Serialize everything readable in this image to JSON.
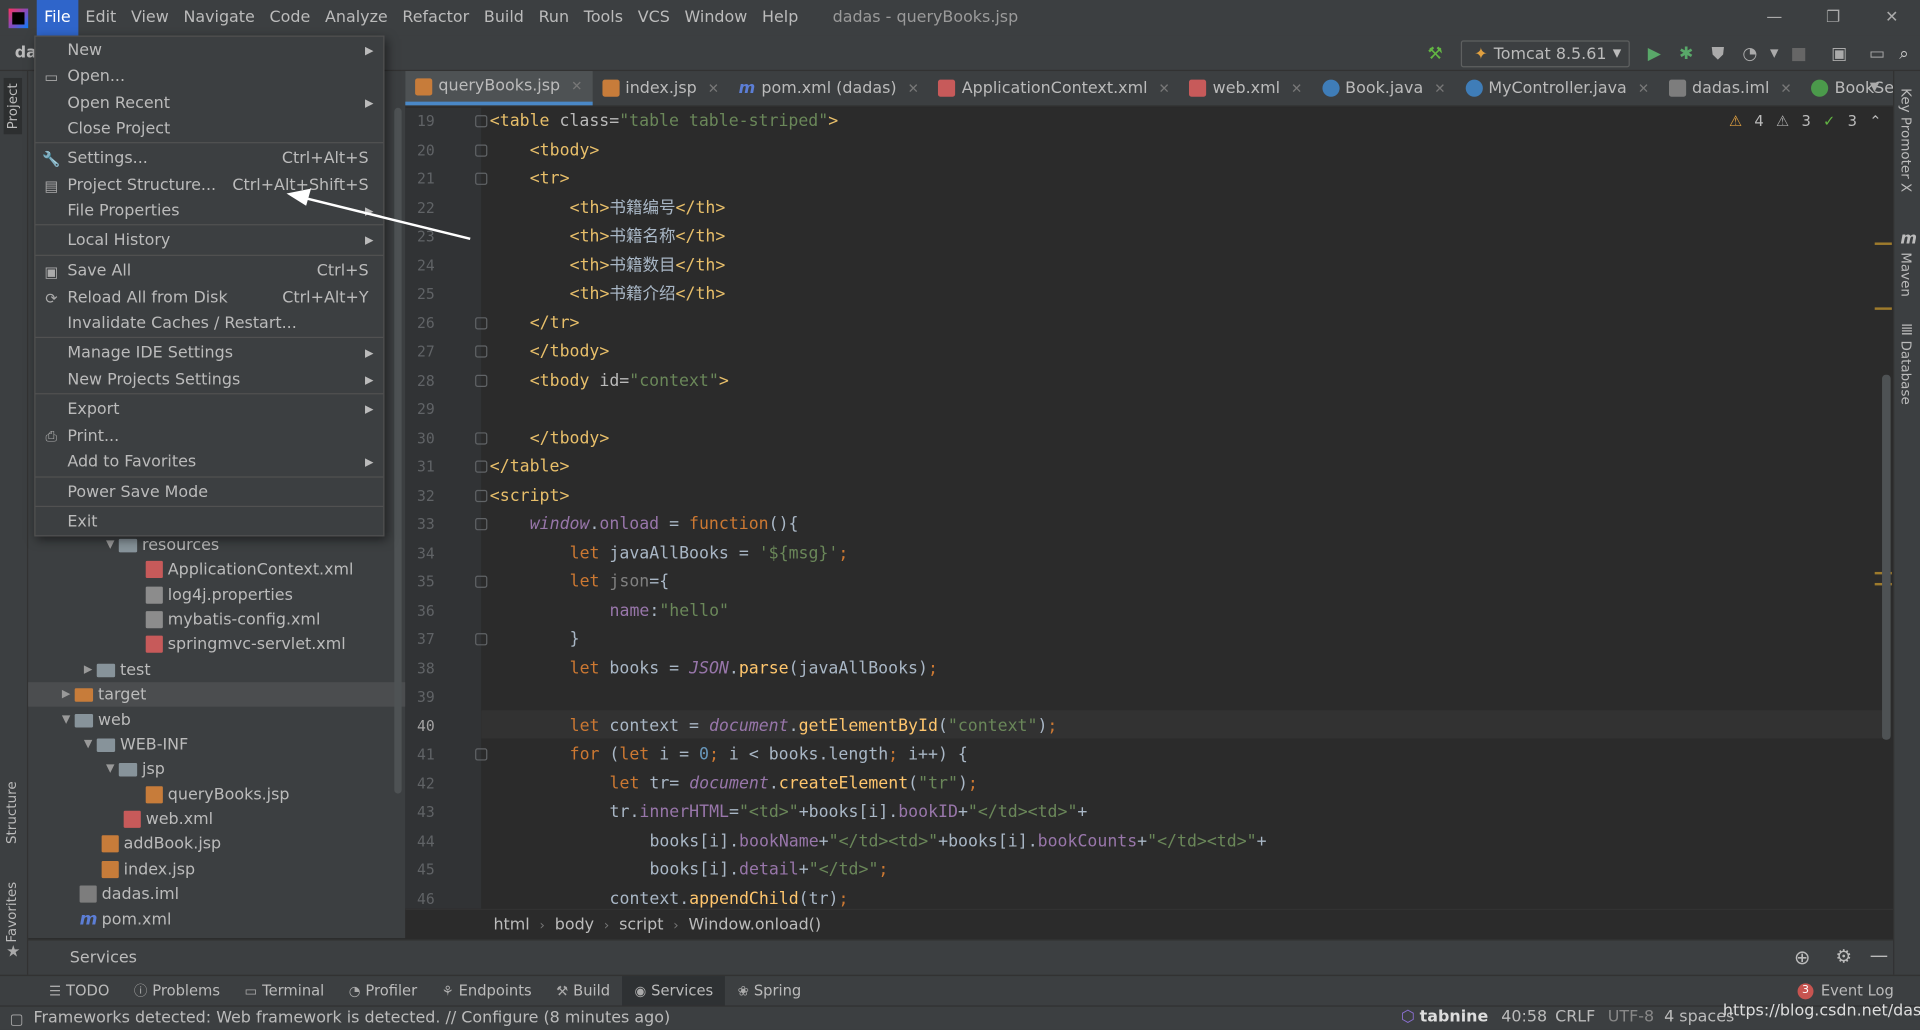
{
  "menubar": {
    "items": [
      "File",
      "Edit",
      "View",
      "Navigate",
      "Code",
      "Analyze",
      "Refactor",
      "Build",
      "Run",
      "Tools",
      "VCS",
      "Window",
      "Help"
    ],
    "title": "dadas - queryBooks.jsp"
  },
  "toolbar": {
    "project_label": "da",
    "run_config": "Tomcat 8.5.61"
  },
  "file_menu": {
    "items": [
      {
        "label": "New",
        "shortcut": "",
        "submenu": true
      },
      {
        "label": "Open...",
        "shortcut": "",
        "submenu": false
      },
      {
        "label": "Open Recent",
        "shortcut": "",
        "submenu": true
      },
      {
        "label": "Close Project",
        "shortcut": "",
        "submenu": false
      },
      {
        "label": "Settings...",
        "shortcut": "Ctrl+Alt+S",
        "submenu": false
      },
      {
        "label": "Project Structure...",
        "shortcut": "Ctrl+Alt+Shift+S",
        "submenu": false
      },
      {
        "label": "File Properties",
        "shortcut": "",
        "submenu": true
      },
      {
        "label": "Local History",
        "shortcut": "",
        "submenu": true
      },
      {
        "label": "Save All",
        "shortcut": "Ctrl+S",
        "submenu": false
      },
      {
        "label": "Reload All from Disk",
        "shortcut": "Ctrl+Alt+Y",
        "submenu": false
      },
      {
        "label": "Invalidate Caches / Restart...",
        "shortcut": "",
        "submenu": false
      },
      {
        "label": "Manage IDE Settings",
        "shortcut": "",
        "submenu": true
      },
      {
        "label": "New Projects Settings",
        "shortcut": "",
        "submenu": true
      },
      {
        "label": "Export",
        "shortcut": "",
        "submenu": true
      },
      {
        "label": "Print...",
        "shortcut": "",
        "submenu": false
      },
      {
        "label": "Add to Favorites",
        "shortcut": "",
        "submenu": true
      },
      {
        "label": "Power Save Mode",
        "shortcut": "",
        "submenu": false
      },
      {
        "label": "Exit",
        "shortcut": "",
        "submenu": false
      }
    ]
  },
  "project_tree": [
    {
      "label": "resources",
      "type": "folder",
      "expanded": true
    },
    {
      "label": "ApplicationContext.xml",
      "type": "xml"
    },
    {
      "label": "log4j.properties",
      "type": "prop"
    },
    {
      "label": "mybatis-config.xml",
      "type": "prop"
    },
    {
      "label": "springmvc-servlet.xml",
      "type": "xml"
    },
    {
      "label": "test",
      "type": "folder",
      "expanded": false
    },
    {
      "label": "target",
      "type": "folder-orange",
      "expanded": false
    },
    {
      "label": "web",
      "type": "folder",
      "expanded": true
    },
    {
      "label": "WEB-INF",
      "type": "folder",
      "expanded": true
    },
    {
      "label": "jsp",
      "type": "folder",
      "expanded": true
    },
    {
      "label": "queryBooks.jsp",
      "type": "jsp"
    },
    {
      "label": "web.xml",
      "type": "xml"
    },
    {
      "label": "addBook.jsp",
      "type": "jsp"
    },
    {
      "label": "index.jsp",
      "type": "jsp"
    },
    {
      "label": "dadas.iml",
      "type": "iml"
    },
    {
      "label": "pom.xml",
      "type": "maven"
    }
  ],
  "tabs": [
    {
      "label": "queryBooks.jsp",
      "icon": "jsp",
      "active": true
    },
    {
      "label": "index.jsp",
      "icon": "jsp",
      "active": false
    },
    {
      "label": "pom.xml (dadas)",
      "icon": "m",
      "active": false
    },
    {
      "label": "ApplicationContext.xml",
      "icon": "xml",
      "active": false
    },
    {
      "label": "web.xml",
      "icon": "xml",
      "active": false
    },
    {
      "label": "Book.java",
      "icon": "java",
      "active": false
    },
    {
      "label": "MyController.java",
      "icon": "java",
      "active": false
    },
    {
      "label": "dadas.iml",
      "icon": "iml",
      "active": false
    },
    {
      "label": "BookService.jav",
      "icon": "iface",
      "active": false
    }
  ],
  "inspections": {
    "warnings": "4",
    "weak": "3",
    "ok": "3"
  },
  "editor": {
    "current_line": 40,
    "lines": [
      {
        "n": 19,
        "indent": 0,
        "segs": [
          [
            "tag",
            "<table "
          ],
          [
            "at",
            "class="
          ],
          [
            "av",
            "\"table table-striped\""
          ],
          [
            "tag",
            ">"
          ]
        ]
      },
      {
        "n": 20,
        "indent": 1,
        "segs": [
          [
            "tag",
            "<tbody>"
          ]
        ]
      },
      {
        "n": 21,
        "indent": 1,
        "segs": [
          [
            "tag",
            "<tr>"
          ]
        ]
      },
      {
        "n": 22,
        "indent": 2,
        "segs": [
          [
            "tag",
            "<th>"
          ],
          [
            "txt",
            "书籍编号"
          ],
          [
            "tag",
            "</th>"
          ]
        ]
      },
      {
        "n": 23,
        "indent": 2,
        "segs": [
          [
            "tag",
            "<th>"
          ],
          [
            "txt",
            "书籍名称"
          ],
          [
            "tag",
            "</th>"
          ]
        ]
      },
      {
        "n": 24,
        "indent": 2,
        "segs": [
          [
            "tag",
            "<th>"
          ],
          [
            "txt",
            "书籍数目"
          ],
          [
            "tag",
            "</th>"
          ]
        ]
      },
      {
        "n": 25,
        "indent": 2,
        "segs": [
          [
            "tag",
            "<th>"
          ],
          [
            "txt",
            "书籍介绍"
          ],
          [
            "tag",
            "</th>"
          ]
        ]
      },
      {
        "n": 26,
        "indent": 1,
        "segs": [
          [
            "tag",
            "</tr>"
          ]
        ]
      },
      {
        "n": 27,
        "indent": 1,
        "segs": [
          [
            "tag",
            "</tbody>"
          ]
        ]
      },
      {
        "n": 28,
        "indent": 1,
        "segs": [
          [
            "tag",
            "<tbody "
          ],
          [
            "at",
            "id="
          ],
          [
            "av",
            "\"context\""
          ],
          [
            "tag",
            ">"
          ]
        ]
      },
      {
        "n": 29,
        "indent": 0,
        "segs": []
      },
      {
        "n": 30,
        "indent": 1,
        "segs": [
          [
            "tag",
            "</tbody>"
          ]
        ]
      },
      {
        "n": 31,
        "indent": 0,
        "segs": [
          [
            "tag",
            "</table>"
          ]
        ]
      },
      {
        "n": 32,
        "indent": 0,
        "segs": [
          [
            "tag",
            "<script>"
          ]
        ]
      },
      {
        "n": 33,
        "indent": 1,
        "segs": [
          [
            "gl",
            "window"
          ],
          [
            "txt",
            "."
          ],
          [
            "pr",
            "onload"
          ],
          [
            "txt",
            " = "
          ],
          [
            "kw",
            "function"
          ],
          [
            "txt",
            "(){"
          ]
        ]
      },
      {
        "n": 34,
        "indent": 2,
        "segs": [
          [
            "kw",
            "let "
          ],
          [
            "txt",
            "javaAllBooks = "
          ],
          [
            "st",
            "'${msg}'"
          ],
          [
            "kw",
            ";"
          ]
        ]
      },
      {
        "n": 35,
        "indent": 2,
        "segs": [
          [
            "kw",
            "let "
          ],
          [
            "dim",
            "json"
          ],
          [
            "txt",
            "={"
          ]
        ]
      },
      {
        "n": 36,
        "indent": 3,
        "segs": [
          [
            "pr",
            "name"
          ],
          [
            "txt",
            ":"
          ],
          [
            "st",
            "\"hello\""
          ]
        ]
      },
      {
        "n": 37,
        "indent": 2,
        "segs": [
          [
            "txt",
            "}"
          ]
        ]
      },
      {
        "n": 38,
        "indent": 2,
        "segs": [
          [
            "kw",
            "let "
          ],
          [
            "txt",
            "books = "
          ],
          [
            "gl",
            "JSON"
          ],
          [
            "txt",
            "."
          ],
          [
            "fn",
            "parse"
          ],
          [
            "txt",
            "(javaAllBooks)"
          ],
          [
            "kw",
            ";"
          ]
        ]
      },
      {
        "n": 39,
        "indent": 0,
        "segs": []
      },
      {
        "n": 40,
        "indent": 2,
        "segs": [
          [
            "kw",
            "let "
          ],
          [
            "txt",
            "context = "
          ],
          [
            "gl",
            "document"
          ],
          [
            "txt",
            "."
          ],
          [
            "fn",
            "getElementById"
          ],
          [
            "txt",
            "("
          ],
          [
            "st",
            "\"context\""
          ],
          [
            "txt",
            ")"
          ],
          [
            "kw",
            ";"
          ]
        ]
      },
      {
        "n": 41,
        "indent": 2,
        "segs": [
          [
            "kw",
            "for "
          ],
          [
            "txt",
            "("
          ],
          [
            "kw",
            "let "
          ],
          [
            "txt",
            "i = "
          ],
          [
            "num",
            "0"
          ],
          [
            "kw",
            "; "
          ],
          [
            "txt",
            "i < books.length"
          ],
          [
            "kw",
            "; "
          ],
          [
            "txt",
            "i++) {"
          ]
        ]
      },
      {
        "n": 42,
        "indent": 3,
        "segs": [
          [
            "kw",
            "let "
          ],
          [
            "txt",
            "tr= "
          ],
          [
            "gl",
            "document"
          ],
          [
            "txt",
            "."
          ],
          [
            "fn",
            "createElement"
          ],
          [
            "txt",
            "("
          ],
          [
            "st",
            "\"tr\""
          ],
          [
            "txt",
            ")"
          ],
          [
            "kw",
            ";"
          ]
        ]
      },
      {
        "n": 43,
        "indent": 3,
        "segs": [
          [
            "txt",
            "tr."
          ],
          [
            "pr",
            "innerHTML"
          ],
          [
            "txt",
            "="
          ],
          [
            "st",
            "\"<td>\""
          ],
          [
            "txt",
            "+books[i]."
          ],
          [
            "pr",
            "bookID"
          ],
          [
            "txt",
            "+"
          ],
          [
            "st",
            "\"</td><td>\""
          ],
          [
            "txt",
            "+"
          ]
        ]
      },
      {
        "n": 44,
        "indent": 4,
        "segs": [
          [
            "txt",
            "books[i]."
          ],
          [
            "pr",
            "bookName"
          ],
          [
            "txt",
            "+"
          ],
          [
            "st",
            "\"</td><td>\""
          ],
          [
            "txt",
            "+books[i]."
          ],
          [
            "pr",
            "bookCounts"
          ],
          [
            "txt",
            "+"
          ],
          [
            "st",
            "\"</td><td>\""
          ],
          [
            "txt",
            "+"
          ]
        ]
      },
      {
        "n": 45,
        "indent": 4,
        "segs": [
          [
            "txt",
            "books[i]."
          ],
          [
            "pr",
            "detail"
          ],
          [
            "txt",
            "+"
          ],
          [
            "st",
            "\"</td>\""
          ],
          [
            "kw",
            ";"
          ]
        ]
      },
      {
        "n": 46,
        "indent": 3,
        "segs": [
          [
            "txt",
            "context."
          ],
          [
            "fn",
            "appendChild"
          ],
          [
            "txt",
            "(tr)"
          ],
          [
            "kw",
            ";"
          ]
        ]
      }
    ]
  },
  "breadcrumbs": [
    "html",
    "body",
    "script",
    "Window.onload()"
  ],
  "services_label": "Services",
  "left_tabs": {
    "project": "Project",
    "structure": "Structure",
    "favorites": "Favorites"
  },
  "right_tabs": {
    "key_promoter": "Key Promoter X",
    "maven": "Maven",
    "database": "Database"
  },
  "bottom_tabs": [
    "TODO",
    "Problems",
    "Terminal",
    "Profiler",
    "Endpoints",
    "Build",
    "Services",
    "Spring"
  ],
  "event_log": {
    "label": "Event Log",
    "count": "3"
  },
  "status": {
    "message": "Frameworks detected: Web framework is detected. // Configure (8 minutes ago)",
    "tabnine": "tabnine",
    "position": "40:58",
    "line_sep": "CRLF",
    "encoding": "UTF-8",
    "indent": "4 spaces",
    "watermark": "https://blog.csdn.net/daseg"
  }
}
